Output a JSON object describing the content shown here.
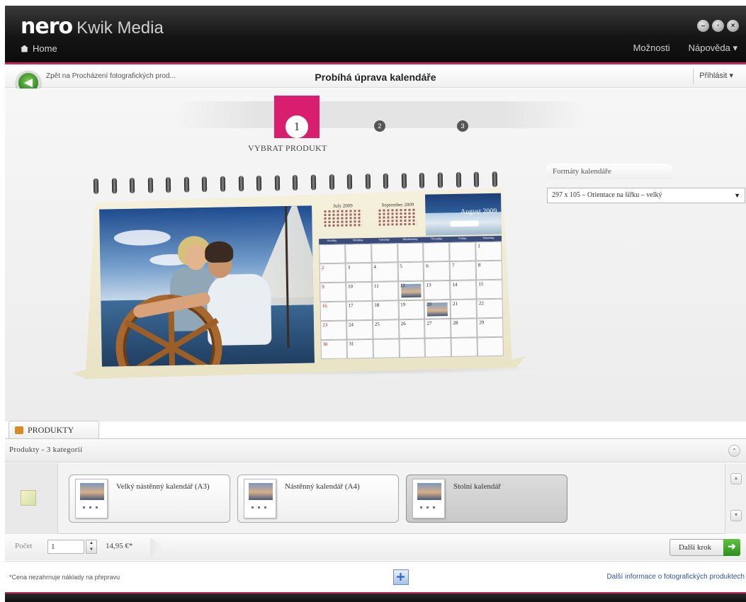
{
  "app": {
    "brand_bold": "nero",
    "brand_light": "Kwik Media",
    "home_label": "Home",
    "menu": [
      "Možnosti",
      "Nápověda ▾"
    ],
    "window_buttons": [
      "minimize-icon",
      "restore-icon",
      "close-icon"
    ]
  },
  "nav": {
    "back_label": "Zpět na Procházení fotografických prod...",
    "page_title": "Probíhá úprava kalendáře",
    "login_label": "Přihlásit ▾"
  },
  "stepper": {
    "active_step": "1",
    "step2": "2",
    "step3": "3",
    "active_label": "VYBRAT PRODUKT"
  },
  "calendar_preview": {
    "month_title": "August 2009",
    "mini_months": [
      "July 2009",
      "September 2009"
    ],
    "weekdays": [
      "Sunday",
      "Monday",
      "Tuesday",
      "Wednesday",
      "Thursday",
      "Friday",
      "Saturday"
    ],
    "days": [
      "",
      "",
      "",
      "",
      "",
      "",
      "1",
      "2",
      "3",
      "4",
      "5",
      "6",
      "7",
      "8",
      "9",
      "10",
      "11",
      "12",
      "13",
      "14",
      "15",
      "16",
      "17",
      "18",
      "19",
      "20",
      "21",
      "22",
      "23",
      "24",
      "25",
      "26",
      "27",
      "28",
      "29",
      "30",
      "31",
      "",
      "",
      "",
      "",
      ""
    ]
  },
  "formats": {
    "tab_label": "Formáty kalendáře",
    "selected": "297 x 105 – Orientace na šířku – velký"
  },
  "products": {
    "tab_label": "PRODUKTY",
    "header": "Produkty - 3 kategorií",
    "items": [
      {
        "name": "Velký nástěnný kalendář (A3)"
      },
      {
        "name": "Nástěnný kalendář (A4)"
      },
      {
        "name": "Stolní kalendář"
      }
    ],
    "selected_index": 2
  },
  "order": {
    "qty_label": "Počet",
    "qty_value": "1",
    "price": "14,95 €*",
    "next_label": "Další krok"
  },
  "footer": {
    "note": "*Cena nezahrnuje náklady na přepravu",
    "link": "Další informace o fotografických produktech"
  },
  "colors": {
    "accent": "#d91e6f",
    "go_green": "#3fa82a",
    "link_blue": "#2a55a6"
  }
}
